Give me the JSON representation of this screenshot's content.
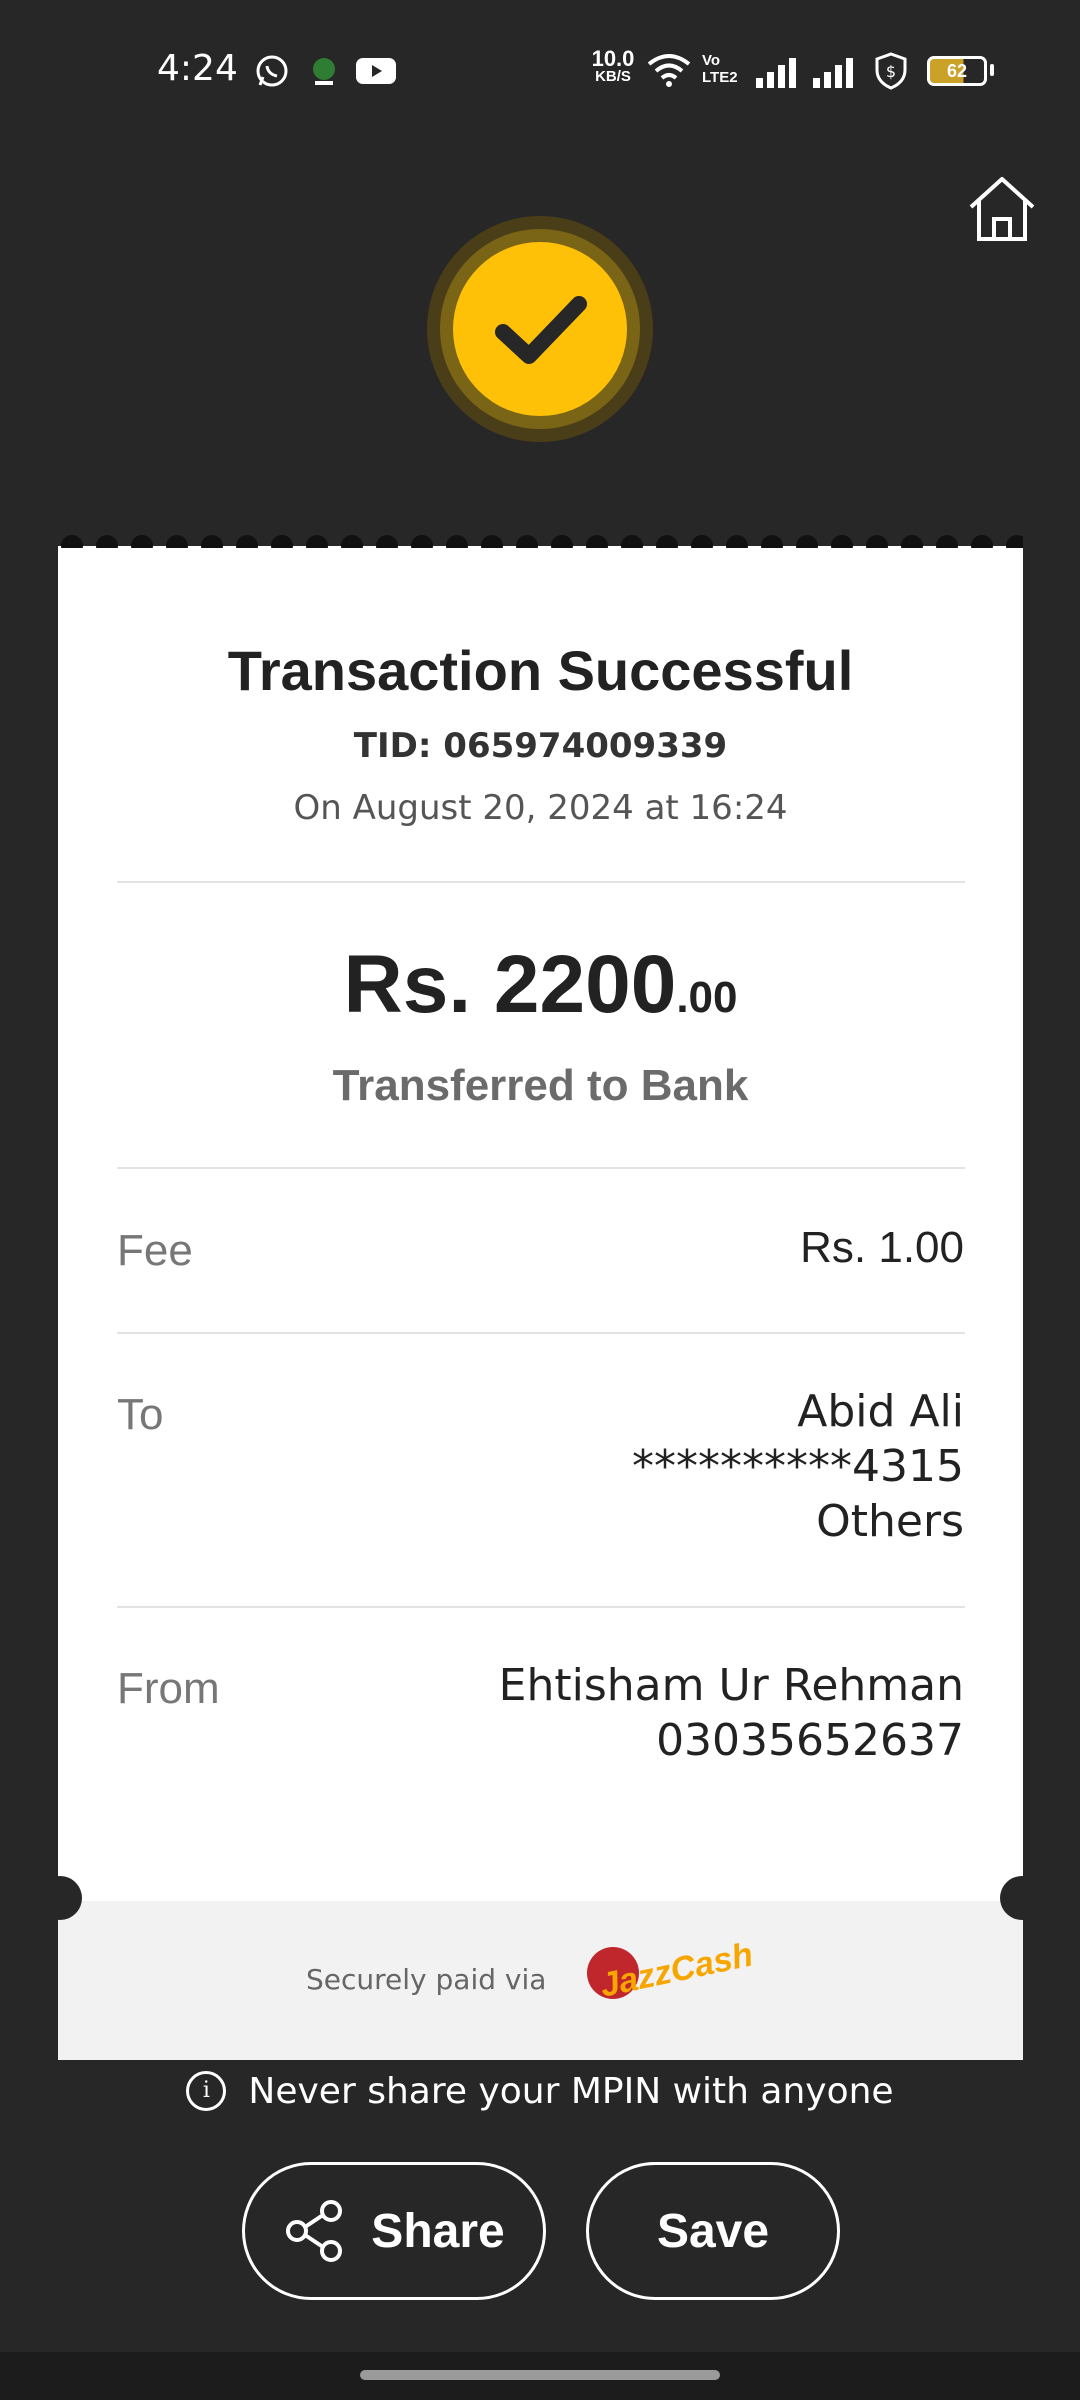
{
  "status_bar": {
    "time": "4:24",
    "net_speed_value": "10.0",
    "net_speed_unit": "KB/S",
    "volte": "Vo LTE2",
    "battery": "62",
    "icons": [
      "whatsapp-icon",
      "app-notification-icon",
      "youtube-icon",
      "wifi-icon",
      "signal-icon",
      "signal-icon",
      "security-icon",
      "battery-icon"
    ]
  },
  "header": {
    "home_icon": "home-icon"
  },
  "badge": {
    "icon": "checkmark-icon",
    "color": "#ffc107"
  },
  "receipt": {
    "title": "Transaction Successful",
    "tid": "TID: 065974009339",
    "date": "On August 20, 2024 at 16:24",
    "amount_main": "Rs. 2200",
    "amount_decimal": ".00",
    "subtitle": "Transferred to Bank",
    "fee": {
      "label": "Fee",
      "value": "Rs. 1.00"
    },
    "to": {
      "label": "To",
      "name": "Abid Ali",
      "account": "**********4315",
      "bank": "Others"
    },
    "from": {
      "label": "From",
      "name": "Ehtisham Ur Rehman",
      "account": "03035652637"
    },
    "footer": {
      "secure_text": "Securely paid via",
      "logo_text": "JazzCash"
    }
  },
  "notice": {
    "text": "Never share your MPIN with anyone",
    "icon": "info-icon"
  },
  "actions": {
    "share_label": "Share",
    "save_label": "Save",
    "share_icon": "share-icon"
  }
}
